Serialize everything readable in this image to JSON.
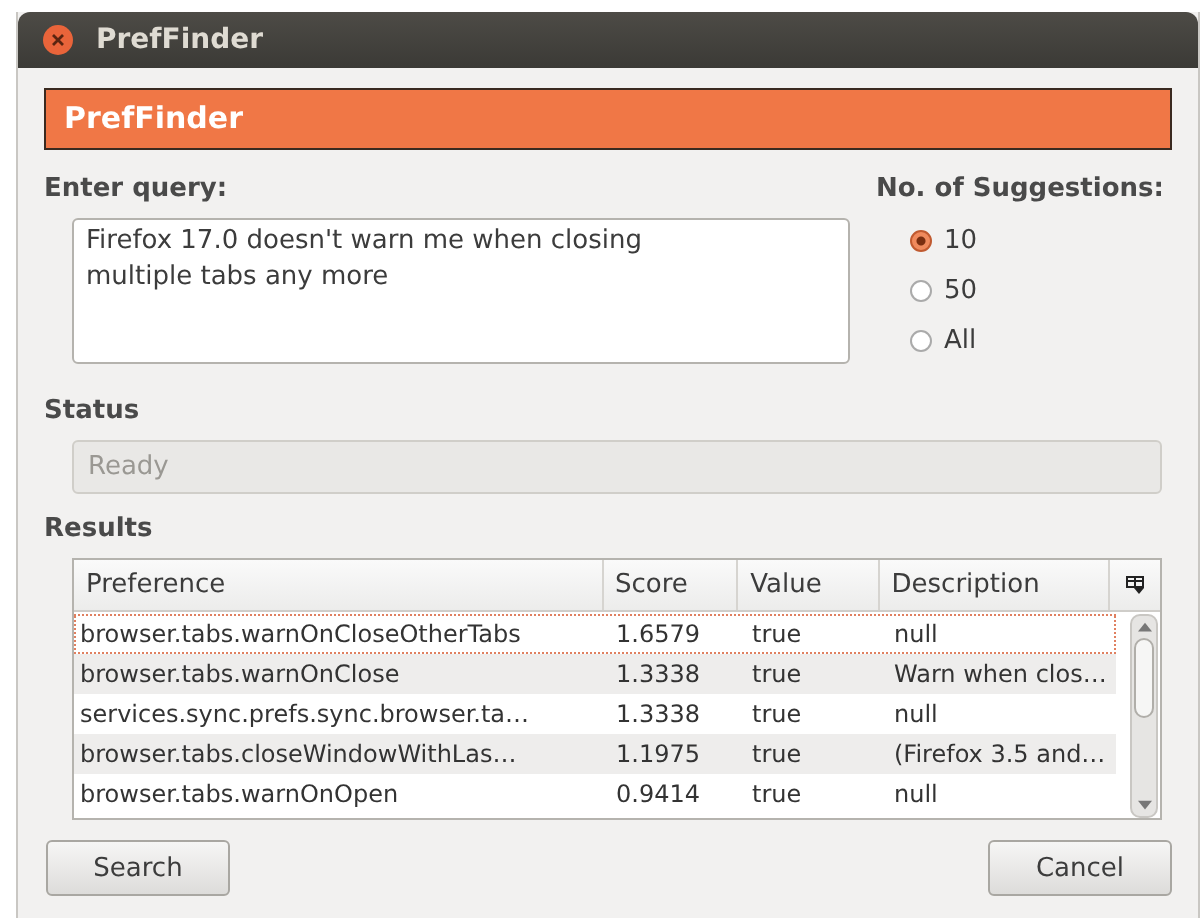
{
  "window": {
    "title": "PrefFinder"
  },
  "banner": "PrefFinder",
  "query": {
    "label": "Enter query:",
    "value": "Firefox 17.0 doesn't warn me when closing multiple tabs any more"
  },
  "suggestions": {
    "label": "No. of Suggestions:",
    "options": [
      {
        "label": "10",
        "selected": true
      },
      {
        "label": "50",
        "selected": false
      },
      {
        "label": "All",
        "selected": false
      }
    ]
  },
  "status": {
    "label": "Status",
    "value": "Ready"
  },
  "results": {
    "label": "Results",
    "columns": [
      "Preference",
      "Score",
      "Value",
      "Description"
    ],
    "rows": [
      {
        "cells": [
          "browser.tabs.warnOnCloseOtherTabs",
          "1.6579",
          "true",
          "null"
        ],
        "selected": true
      },
      {
        "cells": [
          "browser.tabs.warnOnClose",
          "1.3338",
          "true",
          "Warn when clos…"
        ],
        "selected": false
      },
      {
        "cells": [
          "services.sync.prefs.sync.browser.ta…",
          "1.3338",
          "true",
          "null"
        ],
        "selected": false
      },
      {
        "cells": [
          "browser.tabs.closeWindowWithLas…",
          "1.1975",
          "true",
          "(Firefox 3.5 and…"
        ],
        "selected": false
      },
      {
        "cells": [
          "browser.tabs.warnOnOpen",
          "0.9414",
          "true",
          "null"
        ],
        "selected": false
      }
    ]
  },
  "buttons": [
    "Search",
    "Cancel"
  ]
}
